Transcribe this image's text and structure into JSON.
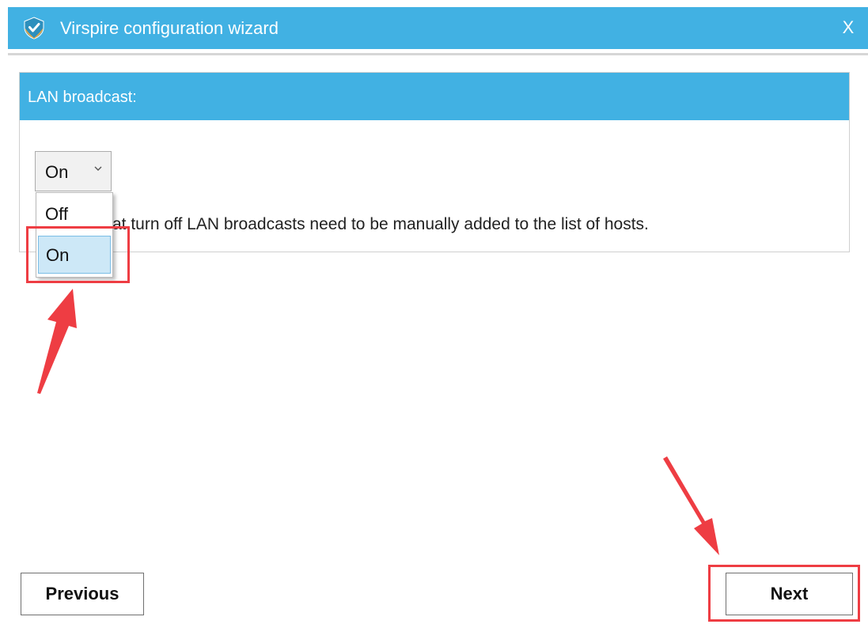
{
  "window": {
    "title": "Virspire configuration wizard",
    "close_label": "X",
    "logo_icon": "shield-check-icon"
  },
  "section": {
    "header": "LAN broadcast:",
    "hint": "at turn off LAN broadcasts need to be manually added to the list of hosts."
  },
  "dropdown": {
    "selected_value": "On",
    "options": [
      "Off",
      "On"
    ],
    "highlighted_option": "On",
    "chevron_icon": "chevron-down-icon"
  },
  "footer": {
    "previous_label": "Previous",
    "next_label": "Next"
  },
  "annotations": {
    "highlight_color": "#ee3d43",
    "arrow_icon": "red-arrow-icon"
  },
  "colors": {
    "accent": "#41b1e3",
    "selected_option_bg": "#cde8f7"
  }
}
